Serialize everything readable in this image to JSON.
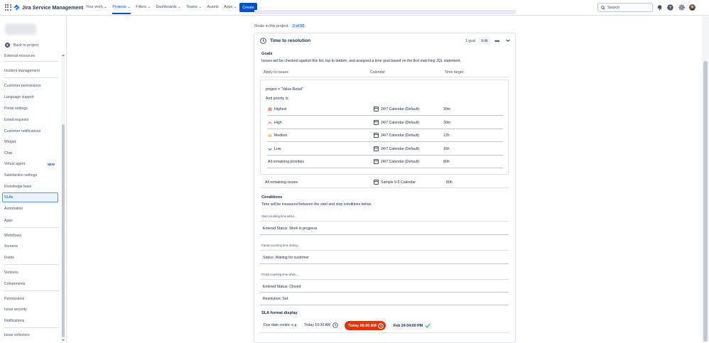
{
  "app": {
    "name": "Jira Service Management"
  },
  "nav": {
    "items": [
      "Your work ⌄",
      "Projects ⌄",
      "Filters ⌄",
      "Dashboards ⌄",
      "Teams ⌄",
      "Assets",
      "Apps ⌄"
    ],
    "create_label": "Create",
    "search_placeholder": "Search"
  },
  "sidebar": {
    "back_label": "Back to project",
    "items": [
      "External resources",
      "Incident management",
      "Customer permissions",
      "Language support",
      "Portal settings",
      "Email requests",
      "Customer notifications",
      "Widget",
      "Chat",
      "Virtual agent",
      "Satisfaction settings",
      "Knowledge base",
      "SLAs",
      "Automation",
      "Apps",
      "Workflows",
      "Screens",
      "Fields",
      "Versions",
      "Components",
      "Permissions",
      "Issue security",
      "Notifications",
      "Issue collectors"
    ],
    "new_badge": "NEW"
  },
  "main": {
    "goals_in_project_label": "Goals in this project:",
    "goals_in_project_count": "2 of 50",
    "sla": {
      "title": "Time to resolution",
      "goal_count": "1 goal",
      "edit_label": "Edit",
      "goals_heading": "Goals",
      "goals_description": "Issues will be checked against this list, top to bottom, and assigned a time goal based on the first matching JQL statement.",
      "columns": [
        "Apply to issues",
        "Calendar",
        "Time target"
      ],
      "jql": "project = \"Value Retail\"",
      "and_priority": "And priority is:",
      "rows": [
        {
          "label": "Highest",
          "calendar": "24/7 Calendar (Default)",
          "target": "30m",
          "color": "#ff5630"
        },
        {
          "label": "High",
          "calendar": "24/7 Calendar (Default)",
          "target": "30m",
          "color": "#ff7452"
        },
        {
          "label": "Medium",
          "calendar": "24/7 Calendar (Default)",
          "target": "12h",
          "color": "#ffab00"
        },
        {
          "label": "Low",
          "calendar": "24/7 Calendar (Default)",
          "target": "16h",
          "color": "#2684ff"
        },
        {
          "label": "All remaining priorities",
          "calendar": "24/7 Calendar (Default)",
          "target": "80h"
        }
      ],
      "remaining": {
        "label": "All remaining issues",
        "calendar": "Sample 9-5 Calendar",
        "target": "80h"
      },
      "conditions_heading": "Conditions",
      "conditions_description": "Time will be measured between the start and stop conditions below.",
      "start_label": "Start counting time when...",
      "start_value": "Entered Status: Work in progress",
      "pause_label": "Pause counting time during...",
      "pause_value": "Status: Waiting for customer",
      "finish_label": "Finish counting time when...",
      "finish_values": [
        "Entered Status: Closed",
        "Resolution: Set"
      ],
      "format_heading": "SLA format display",
      "format_label": "Due date centric e.g.",
      "format_normal": "Today 10:30 AM",
      "format_breached": "Today 06:00 AM",
      "format_met": "Feb 24 04:00 PM"
    }
  },
  "colors": {
    "accent": "#0052cc",
    "breached": "#de350b",
    "met": "#36b37e"
  }
}
